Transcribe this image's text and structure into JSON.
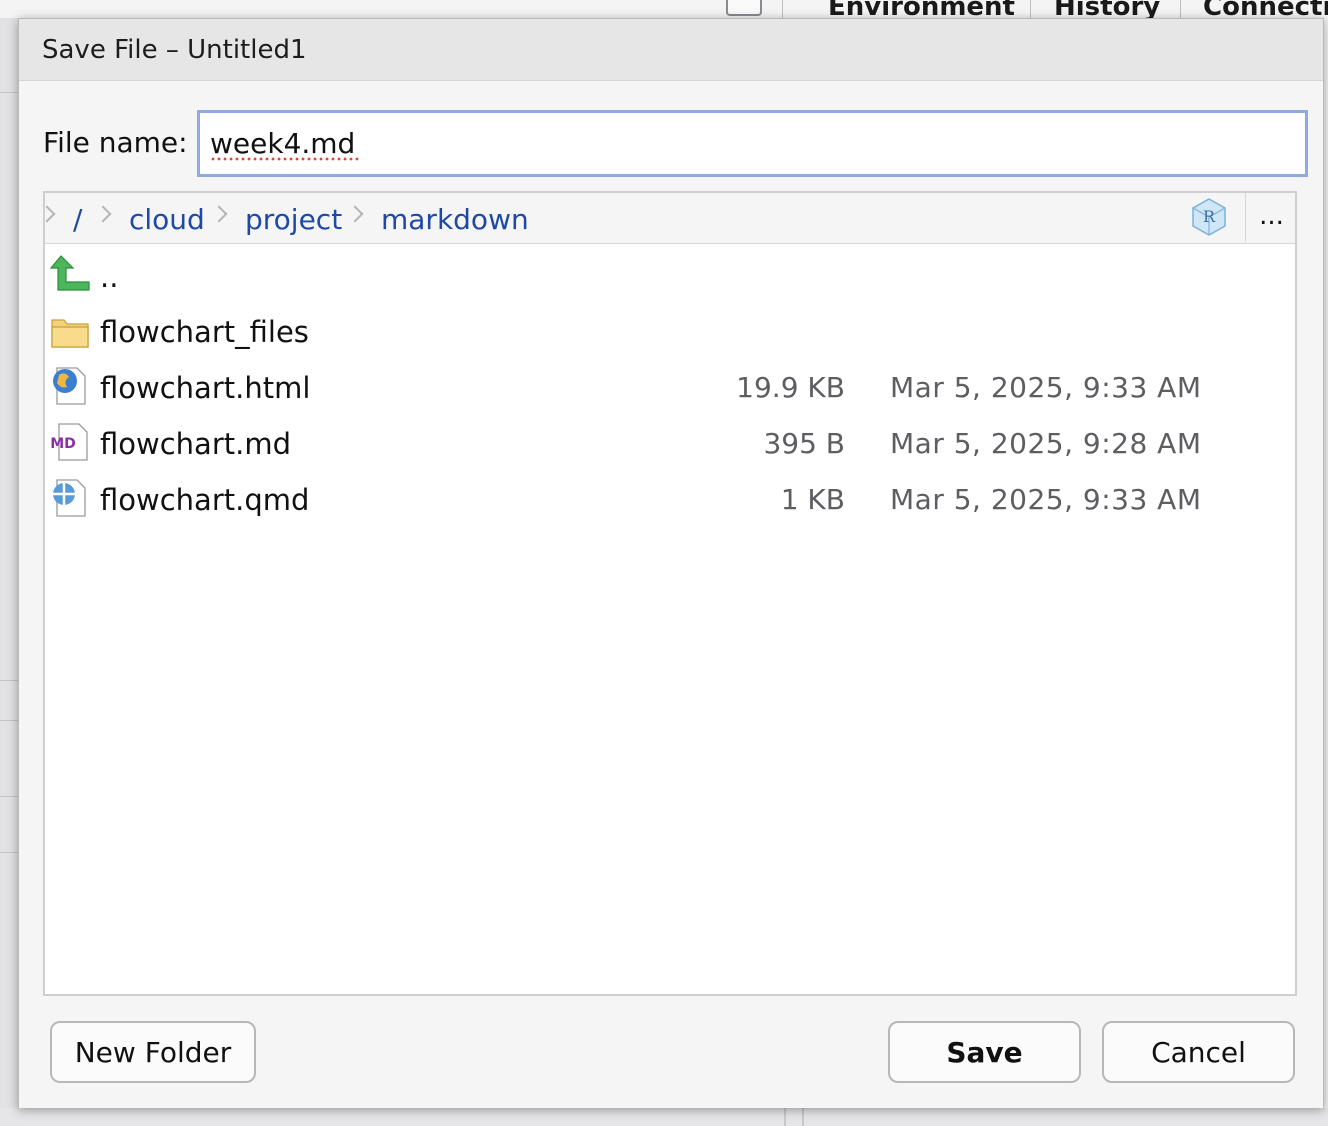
{
  "background": {
    "tabs": [
      "Environment",
      "History",
      "Connecti"
    ]
  },
  "dialog": {
    "title": "Save File – Untitled1",
    "file_name_label": "File name:",
    "file_name_value": "week4.md"
  },
  "breadcrumb": {
    "items": [
      "/",
      "cloud",
      "project",
      "markdown"
    ],
    "more_label": "..."
  },
  "files": [
    {
      "name": "..",
      "icon": "parent-folder-icon",
      "size": "",
      "modified": ""
    },
    {
      "name": "flowchart_files",
      "icon": "folder-icon",
      "size": "",
      "modified": ""
    },
    {
      "name": "flowchart.html",
      "icon": "html-file-icon",
      "size": "19.9 KB",
      "modified": "Mar 5, 2025, 9:33 AM"
    },
    {
      "name": "flowchart.md",
      "icon": "markdown-file-icon",
      "size": "395 B",
      "modified": "Mar 5, 2025, 9:28 AM"
    },
    {
      "name": "flowchart.qmd",
      "icon": "quarto-file-icon",
      "size": "1 KB",
      "modified": "Mar 5, 2025, 9:33 AM"
    }
  ],
  "buttons": {
    "new_folder": "New Folder",
    "save": "Save",
    "cancel": "Cancel"
  },
  "colors": {
    "link": "#1f4aa3",
    "input_focus": "#8eaadf"
  }
}
